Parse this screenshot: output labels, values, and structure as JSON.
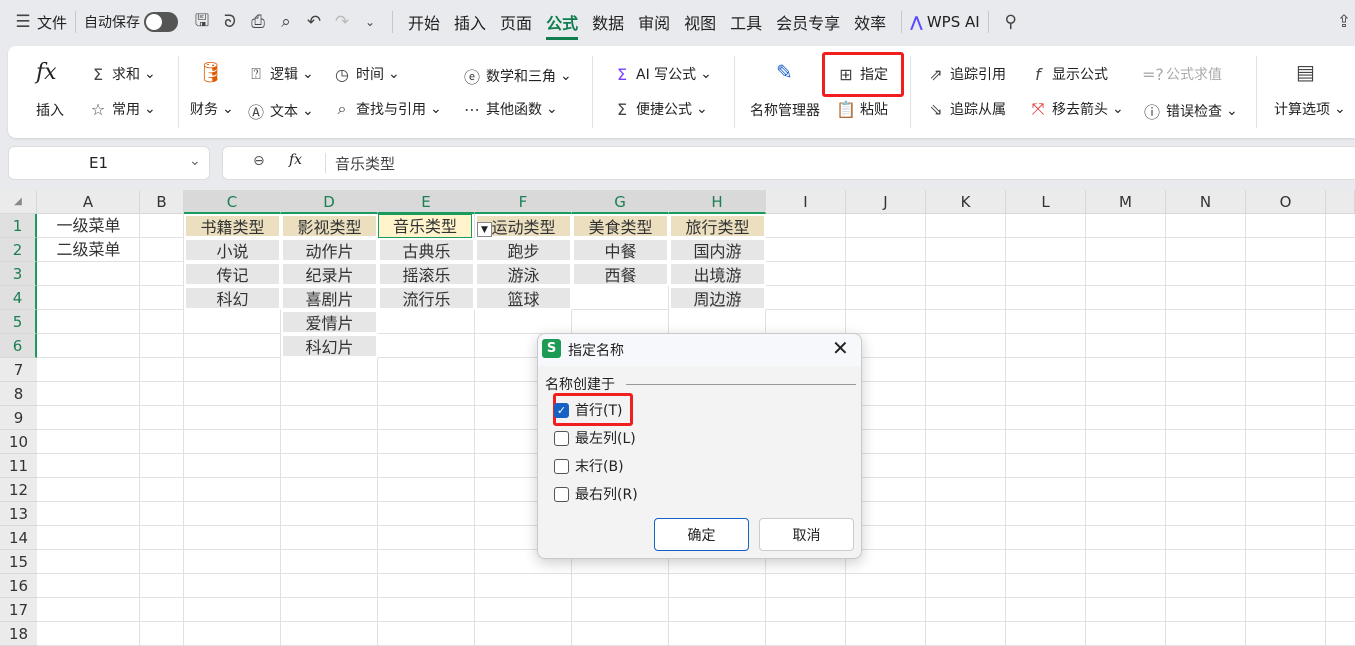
{
  "menu": {
    "file": "文件",
    "autosave": "自动保存",
    "tabs": [
      "开始",
      "插入",
      "页面",
      "公式",
      "数据",
      "审阅",
      "视图",
      "工具",
      "会员专享",
      "效率"
    ],
    "active_tab": "公式",
    "wps_ai": "WPS AI"
  },
  "ribbon": {
    "insert": "插入",
    "sum": "求和",
    "common": "常用",
    "finance": "财务",
    "logic": "逻辑",
    "text": "文本",
    "time": "时间",
    "lookup": "查找与引用",
    "math": "数学和三角",
    "other": "其他函数",
    "ai_formula": "AI 写公式",
    "quick_formula": "便捷公式",
    "name_manager": "名称管理器",
    "specify": "指定",
    "paste": "粘贴",
    "trace_precedents": "追踪引用",
    "trace_dependents": "追踪从属",
    "show_formula": "显示公式",
    "remove_arrows": "移去箭头",
    "evaluate": "公式求值",
    "error_check": "错误检查",
    "calc_options": "计算选项"
  },
  "formula_bar": {
    "cell_ref": "E1",
    "value": "音乐类型"
  },
  "columns": [
    "A",
    "B",
    "C",
    "D",
    "E",
    "F",
    "G",
    "H",
    "I",
    "J",
    "K",
    "L",
    "M",
    "N",
    "O"
  ],
  "rows": [
    "1",
    "2",
    "3",
    "4",
    "5",
    "6",
    "7",
    "8",
    "9",
    "10",
    "11",
    "12",
    "13",
    "14",
    "15",
    "16",
    "17",
    "18"
  ],
  "cells": [
    {
      "ref": "A1",
      "v": "一级菜单"
    },
    {
      "ref": "A2",
      "v": "二级菜单"
    },
    {
      "ref": "C1",
      "v": "书籍类型",
      "s": "head"
    },
    {
      "ref": "C2",
      "v": "小说",
      "s": "fill"
    },
    {
      "ref": "C3",
      "v": "传记",
      "s": "fill"
    },
    {
      "ref": "C4",
      "v": "科幻",
      "s": "fill"
    },
    {
      "ref": "D1",
      "v": "影视类型",
      "s": "head"
    },
    {
      "ref": "D2",
      "v": "动作片",
      "s": "fill"
    },
    {
      "ref": "D3",
      "v": "纪录片",
      "s": "fill"
    },
    {
      "ref": "D4",
      "v": "喜剧片",
      "s": "fill"
    },
    {
      "ref": "D5",
      "v": "爱情片",
      "s": "fill"
    },
    {
      "ref": "D6",
      "v": "科幻片",
      "s": "fill"
    },
    {
      "ref": "E1",
      "v": "音乐类型",
      "s": "active"
    },
    {
      "ref": "E2",
      "v": "古典乐",
      "s": "fill"
    },
    {
      "ref": "E3",
      "v": "摇滚乐",
      "s": "fill"
    },
    {
      "ref": "E4",
      "v": "流行乐",
      "s": "fill"
    },
    {
      "ref": "F1",
      "v": "运动类型",
      "s": "head"
    },
    {
      "ref": "F2",
      "v": "跑步",
      "s": "fill"
    },
    {
      "ref": "F3",
      "v": "游泳",
      "s": "fill"
    },
    {
      "ref": "F4",
      "v": "篮球",
      "s": "fill"
    },
    {
      "ref": "G1",
      "v": "美食类型",
      "s": "head"
    },
    {
      "ref": "G2",
      "v": "中餐",
      "s": "fill"
    },
    {
      "ref": "G3",
      "v": "西餐",
      "s": "fill"
    },
    {
      "ref": "H1",
      "v": "旅行类型",
      "s": "head"
    },
    {
      "ref": "H2",
      "v": "国内游",
      "s": "fill"
    },
    {
      "ref": "H3",
      "v": "出境游",
      "s": "fill"
    },
    {
      "ref": "H4",
      "v": "周边游",
      "s": "fill"
    }
  ],
  "dialog": {
    "title": "指定名称",
    "group": "名称创建于",
    "options": [
      {
        "label": "首行(T)",
        "checked": true
      },
      {
        "label": "最左列(L)",
        "checked": false
      },
      {
        "label": "末行(B)",
        "checked": false
      },
      {
        "label": "最右列(R)",
        "checked": false
      }
    ],
    "ok": "确定",
    "cancel": "取消"
  }
}
